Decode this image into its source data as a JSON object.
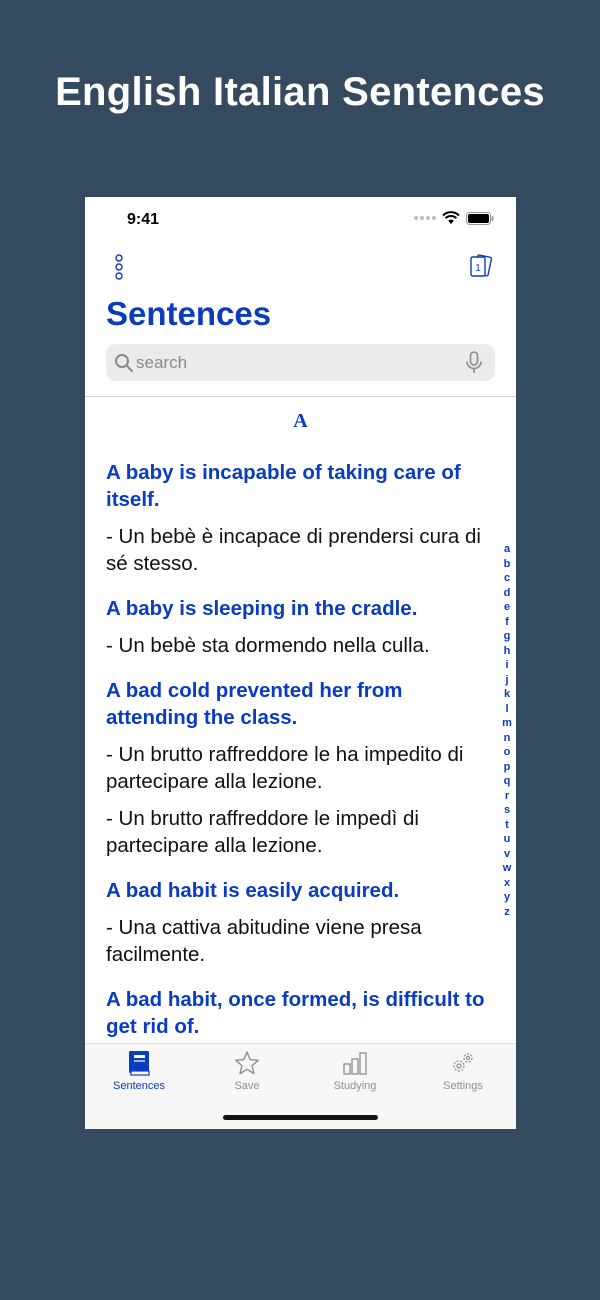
{
  "headline": "English Italian Sentences",
  "status": {
    "time": "9:41"
  },
  "header": {
    "title": "Sentences"
  },
  "search": {
    "placeholder": "search"
  },
  "section": {
    "letter": "A"
  },
  "entries": [
    {
      "en": "A baby is incapable of taking care of itself.",
      "it": [
        "- Un bebè è incapace di prendersi cura di sé stesso."
      ]
    },
    {
      "en": "A baby is sleeping in the cradle.",
      "it": [
        "- Un bebè sta dormendo nella culla."
      ]
    },
    {
      "en": "A bad cold prevented her from attending the class.",
      "it": [
        "- Un brutto raffreddore le ha impedito di partecipare alla lezione.",
        "- Un brutto raffreddore le impedì di partecipare alla lezione."
      ]
    },
    {
      "en": "A bad habit is easily acquired.",
      "it": [
        "- Una cattiva abitudine viene presa facilmente."
      ]
    },
    {
      "en": "A bad habit, once formed, is difficult to get rid of.",
      "it": []
    }
  ],
  "alphabet": [
    "a",
    "b",
    "c",
    "d",
    "e",
    "f",
    "g",
    "h",
    "i",
    "j",
    "k",
    "l",
    "m",
    "n",
    "o",
    "p",
    "q",
    "r",
    "s",
    "t",
    "u",
    "v",
    "w",
    "x",
    "y",
    "z"
  ],
  "tabs": [
    {
      "label": "Sentences",
      "icon": "book-icon",
      "active": true
    },
    {
      "label": "Save",
      "icon": "star-icon",
      "active": false
    },
    {
      "label": "Studying",
      "icon": "bar-chart-icon",
      "active": false
    },
    {
      "label": "Settings",
      "icon": "gears-icon",
      "active": false
    }
  ],
  "colors": {
    "background": "#344a5e",
    "accent": "#0a3cc2",
    "tab_inactive": "#8e8e93"
  },
  "cards_button": {
    "badge": "1"
  }
}
